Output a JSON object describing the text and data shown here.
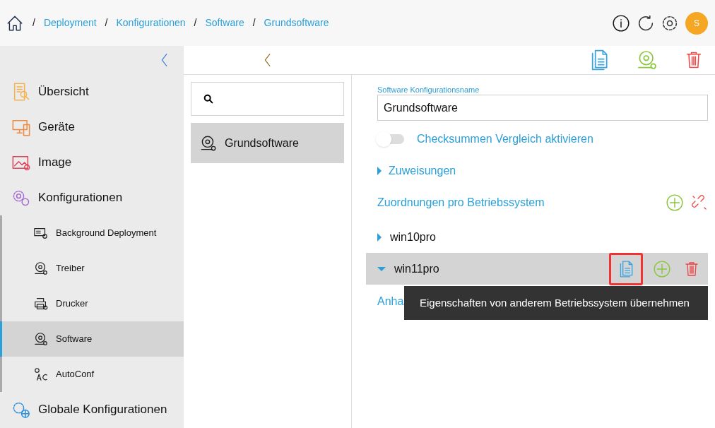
{
  "breadcrumb": [
    {
      "separator": "/",
      "label": "Deployment"
    },
    {
      "separator": "/",
      "label": "Konfigurationen"
    },
    {
      "separator": "/",
      "label": "Software"
    },
    {
      "separator": "/",
      "label": "Grundsoftware"
    }
  ],
  "user": {
    "initial": "S"
  },
  "sidebar": {
    "items": [
      {
        "label": "Übersicht",
        "kind": "overview",
        "selected": false
      },
      {
        "label": "Geräte",
        "kind": "devices",
        "selected": false
      },
      {
        "label": "Image",
        "kind": "image",
        "selected": false
      },
      {
        "label": "Konfigurationen",
        "kind": "config",
        "selected": false,
        "children": [
          {
            "label": "Background Deployment",
            "kind": "background",
            "selected": false
          },
          {
            "label": "Treiber",
            "kind": "disc",
            "selected": false
          },
          {
            "label": "Drucker",
            "kind": "printer",
            "selected": false
          },
          {
            "label": "Software",
            "kind": "disc",
            "selected": true
          },
          {
            "label": "AutoConf",
            "kind": "autoconf",
            "selected": false
          }
        ]
      },
      {
        "label": "Globale Konfigurationen",
        "kind": "global",
        "selected": false
      }
    ]
  },
  "list": {
    "items": [
      {
        "label": "Grundsoftware",
        "selected": true
      }
    ]
  },
  "form": {
    "name_label": "Software Konfigurationsname",
    "name_value": "Grundsoftware",
    "checksum": {
      "label": "Checksummen Vergleich aktivieren",
      "on": false
    },
    "assignments": {
      "label": "Zuweisungen",
      "expanded": false
    },
    "mappings_title": "Zuordnungen pro Betriebssystem",
    "os_items": [
      {
        "label": "win10pro",
        "expanded": false,
        "selected": false
      },
      {
        "label": "win11pro",
        "expanded": true,
        "selected": true,
        "actions": [
          {
            "kind": "copy",
            "highlighted": true
          },
          {
            "kind": "add",
            "highlighted": false
          },
          {
            "kind": "delete",
            "highlighted": false
          }
        ]
      }
    ],
    "halt": {
      "label": "Anha"
    }
  },
  "tooltip": "Eigenschaften von anderem Betriebssystem übernehmen"
}
